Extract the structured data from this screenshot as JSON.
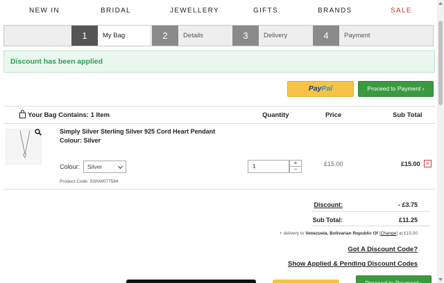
{
  "nav": {
    "items": [
      "NEW IN",
      "BRIDAL",
      "JEWELLERY",
      "GIFTS",
      "BRANDS",
      "SALE"
    ]
  },
  "steps": [
    {
      "num": "1",
      "label": "My Bag"
    },
    {
      "num": "2",
      "label": "Details"
    },
    {
      "num": "3",
      "label": "Delivery"
    },
    {
      "num": "4",
      "label": "Payment"
    }
  ],
  "notice": "Discount has been applied",
  "buttons": {
    "paypal_pay": "Pay",
    "paypal_pal": "Pal",
    "proceed": "Proceed to Payment ›"
  },
  "table": {
    "bag_title": "Your Bag Contains: 1 Item",
    "col_quantity": "Quantity",
    "col_price": "Price",
    "col_subtotal": "Sub Total"
  },
  "item": {
    "name": "Simply Silver Sterling Silver 925 Cord Heart Pendant",
    "colour_line": "Colour: Silver",
    "colour_label": "Colour:",
    "colour_selected": "Silver",
    "product_code": "Product Code: SSNW077564",
    "quantity": "1",
    "qty_plus": "+",
    "qty_minus": "−",
    "price": "£15.00",
    "subtotal": "£15.00",
    "remove": "×"
  },
  "summary": {
    "discount_label": "Discount:",
    "discount_value": "- £3.75",
    "subtotal_label": "Sub Total:",
    "subtotal_value": "£11.25",
    "delivery_prefix": "+ delivery to",
    "delivery_country": "Venezuela, Bolivarian Republic Of",
    "delivery_change": "Change",
    "delivery_suffix": "at £15.00",
    "discount_code_link": "Got A Discount Code?",
    "pending_link": "Show Applied & Pending Discount Codes"
  },
  "colors": {
    "sale": "#c0392b",
    "notice_text": "#2a9d56",
    "proceed_btn": "#3a9a3e",
    "paypal_btn": "#f6c344"
  }
}
